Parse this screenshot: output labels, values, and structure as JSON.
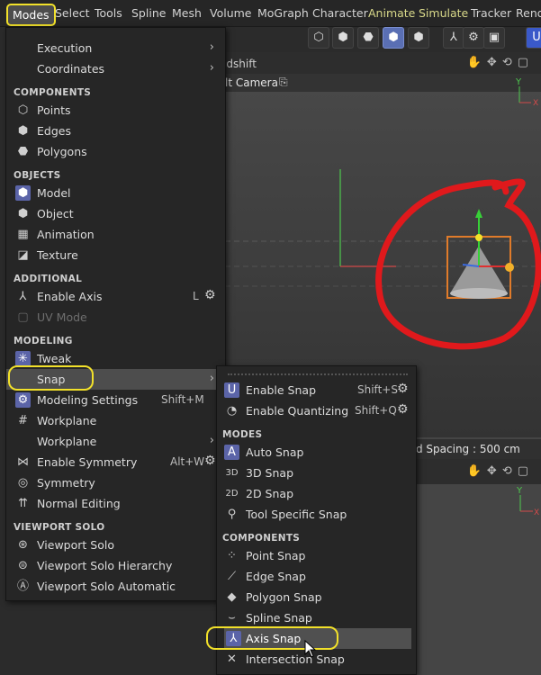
{
  "menubar": {
    "items": [
      "Modes",
      "Select",
      "Tools",
      "Spline",
      "Mesh",
      "Volume",
      "MoGraph",
      "Character",
      "Animate",
      "Simulate",
      "Tracker",
      "Rende"
    ]
  },
  "viewport": {
    "renderer_label": "edshift",
    "camera_label": "lt Camera",
    "grid_spacing": "d Spacing : 500 cm"
  },
  "modes_menu": {
    "execution": "Execution",
    "coordinates": "Coordinates",
    "sec_components": "COMPONENTS",
    "points": "Points",
    "edges": "Edges",
    "polygons": "Polygons",
    "sec_objects": "OBJECTS",
    "model": "Model",
    "object": "Object",
    "animation": "Animation",
    "texture": "Texture",
    "sec_additional": "ADDITIONAL",
    "enable_axis": "Enable Axis",
    "enable_axis_shortcut": "L",
    "uv_mode": "UV Mode",
    "sec_modeling": "MODELING",
    "tweak": "Tweak",
    "snap": "Snap",
    "modeling_settings": "Modeling Settings",
    "modeling_settings_shortcut": "Shift+M",
    "workplane": "Workplane",
    "workplane_sub": "Workplane",
    "enable_symmetry": "Enable Symmetry",
    "enable_symmetry_shortcut": "Alt+W",
    "symmetry": "Symmetry",
    "normal_editing": "Normal Editing",
    "sec_viewport_solo": "VIEWPORT SOLO",
    "viewport_solo": "Viewport Solo",
    "viewport_solo_hierarchy": "Viewport Solo Hierarchy",
    "viewport_solo_automatic": "Viewport Solo Automatic"
  },
  "snap_menu": {
    "enable_snap": "Enable Snap",
    "enable_snap_shortcut": "Shift+S",
    "enable_quantizing": "Enable Quantizing",
    "enable_quantizing_shortcut": "Shift+Q",
    "sec_modes": "MODES",
    "auto_snap": "Auto Snap",
    "snap_3d": "3D Snap",
    "snap_2d": "2D Snap",
    "tool_specific_snap": "Tool Specific Snap",
    "sec_components": "COMPONENTS",
    "point_snap": "Point Snap",
    "edge_snap": "Edge Snap",
    "polygon_snap": "Polygon Snap",
    "spline_snap": "Spline Snap",
    "axis_snap": "Axis Snap",
    "intersection_snap": "Intersection Snap"
  },
  "icons": [
    "modes-icons",
    "gear-icon",
    "chevron-right-icon",
    "magnet-icon",
    "cone-object",
    "axis-gizmo"
  ],
  "colors": {
    "highlight_ring": "#f2e12a",
    "annotation_red": "#e0191c",
    "accent_blue": "#5b64a8",
    "menu_bg": "#262626"
  }
}
